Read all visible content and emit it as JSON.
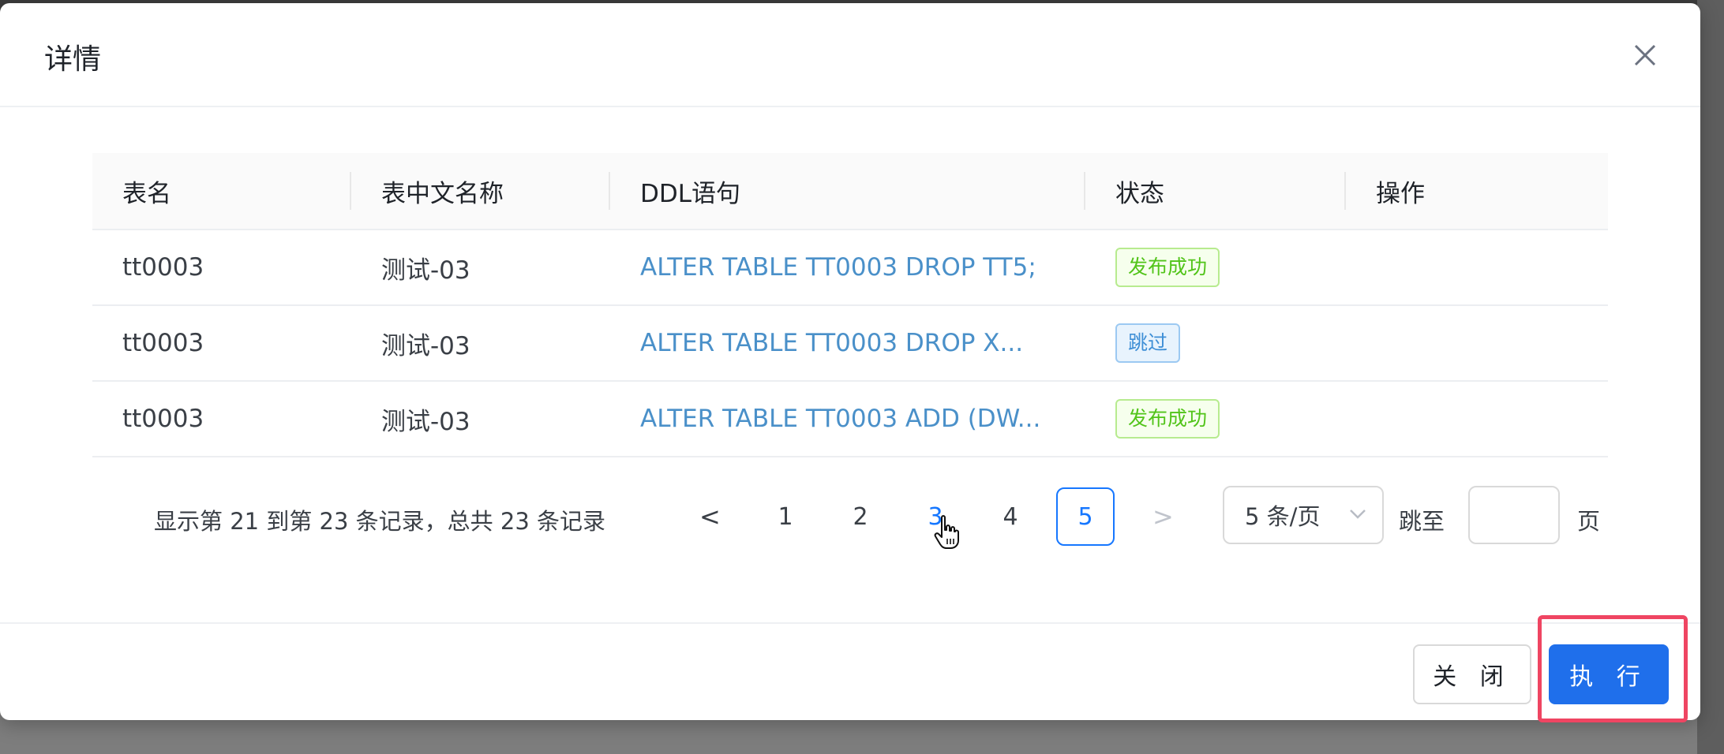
{
  "dialog": {
    "title": "详情"
  },
  "table": {
    "columns": [
      "表名",
      "表中文名称",
      "DDL语句",
      "状态",
      "操作"
    ],
    "rows": [
      {
        "table_name": "tt0003",
        "table_cn_name": "测试-03",
        "ddl": "ALTER TABLE TT0003 DROP TT5;",
        "status": "发布成功",
        "status_type": "success"
      },
      {
        "table_name": "tt0003",
        "table_cn_name": "测试-03",
        "ddl": "ALTER TABLE TT0003 DROP X...",
        "status": "跳过",
        "status_type": "skip"
      },
      {
        "table_name": "tt0003",
        "table_cn_name": "测试-03",
        "ddl": "ALTER TABLE TT0003 ADD (DW...",
        "status": "发布成功",
        "status_type": "success"
      }
    ]
  },
  "pagination": {
    "summary": "显示第 21 到第 23 条记录，总共 23 条记录",
    "prev": "<",
    "next": ">",
    "pages": [
      "1",
      "2",
      "3",
      "4",
      "5"
    ],
    "current_page": "5",
    "page_size": "5 条/页",
    "jump_label": "跳至",
    "jump_value": "",
    "page_suffix": "页"
  },
  "footer": {
    "close_label": "关 闭",
    "execute_label": "执 行"
  },
  "colors": {
    "primary": "#1f6feb",
    "link": "#4a90c9",
    "success": "#52c41a",
    "highlight": "#ef4562"
  }
}
